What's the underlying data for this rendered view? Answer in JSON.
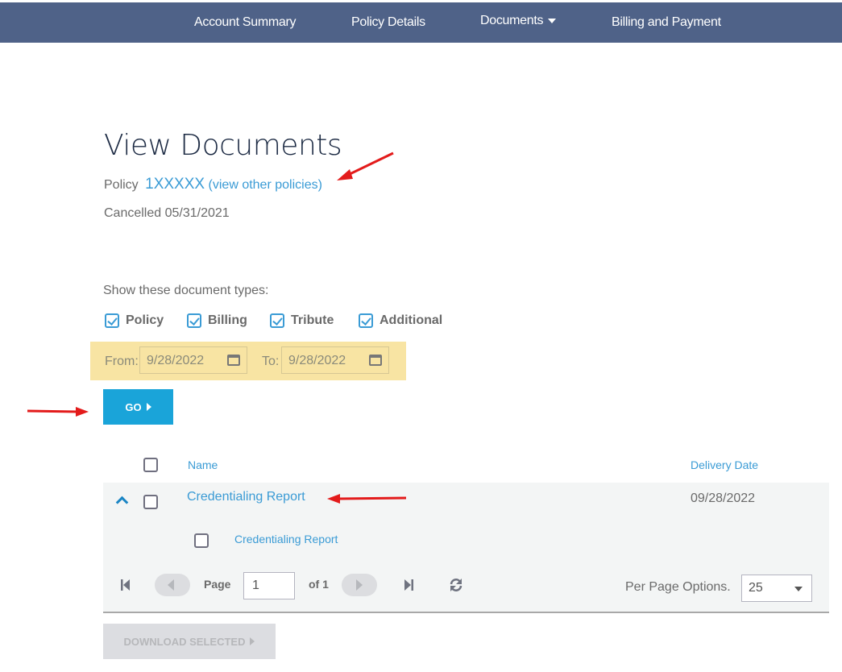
{
  "nav": {
    "items": [
      {
        "label": "Account Summary"
      },
      {
        "label": "Policy Details"
      },
      {
        "label": "Documents",
        "has_dropdown": true
      },
      {
        "label": "Billing and Payment"
      }
    ],
    "bg_color": "#4f6288"
  },
  "page": {
    "title": "View Documents",
    "policy_label": "Policy",
    "policy_number": "1XXXXX",
    "view_other_policies": "(view other policies)",
    "status": "Cancelled 05/31/2021"
  },
  "filters": {
    "types_label": "Show these document types:",
    "types": [
      {
        "label": "Policy",
        "checked": true
      },
      {
        "label": "Billing",
        "checked": true
      },
      {
        "label": "Tribute",
        "checked": true
      },
      {
        "label": "Additional",
        "checked": true
      }
    ],
    "from_label": "From:",
    "from_value": "9/28/2022",
    "to_label": "To:",
    "to_value": "9/28/2022",
    "go_label": "GO"
  },
  "table": {
    "headers": {
      "name": "Name",
      "delivery_date": "Delivery Date"
    },
    "rows": [
      {
        "name": "Credentialing Report",
        "delivery_date": "09/28/2022",
        "expanded": true,
        "children": [
          {
            "name": "Credentialing Report"
          }
        ]
      }
    ]
  },
  "pager": {
    "page_label": "Page",
    "page_value": "1",
    "of_label": "of 1",
    "per_page_label": "Per Page Options.",
    "per_page_value": "25"
  },
  "actions": {
    "download_label": "DOWNLOAD SELECTED"
  },
  "colors": {
    "accent": "#1aa4d9",
    "link": "#3a9bd5",
    "highlight": "#f8e4a3",
    "annotation_arrow": "#e31b1b"
  }
}
